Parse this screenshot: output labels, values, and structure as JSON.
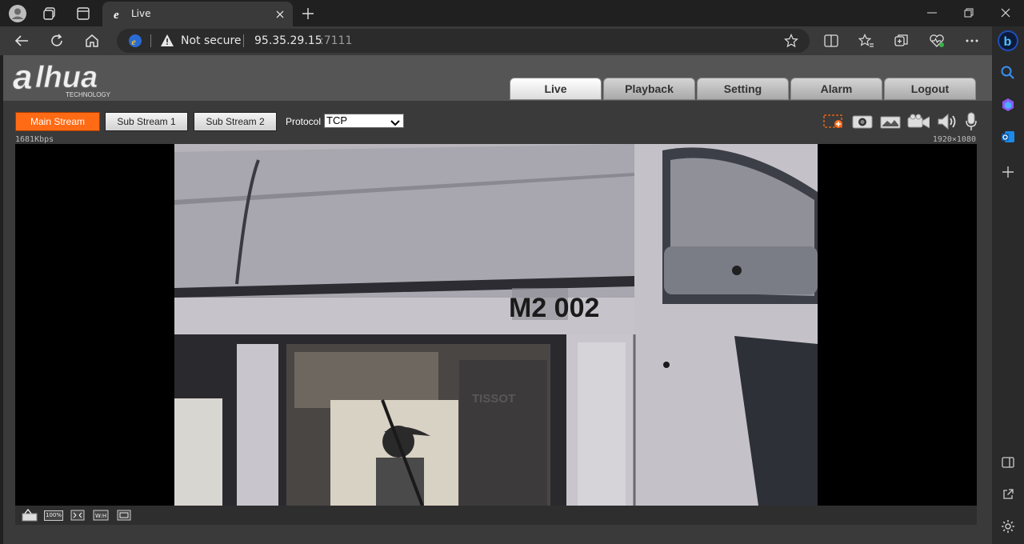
{
  "browser": {
    "tab_title": "Live",
    "url_warning": "Not secure",
    "url_host": "95.35.29.15",
    "url_port": ":7111"
  },
  "app": {
    "logo_text": "alhua",
    "logo_sub": "TECHNOLOGY",
    "menu": [
      "Live",
      "Playback",
      "Setting",
      "Alarm",
      "Logout"
    ],
    "active_menu": "Live"
  },
  "stream": {
    "main": "Main Stream",
    "sub1": "Sub Stream 1",
    "sub2": "Sub Stream 2",
    "protocol_label": "Protocol",
    "protocol_value": "TCP",
    "bitrate": "1681Kbps",
    "resolution": "1920×1080"
  },
  "toolbar_icons": [
    "zoom-region-icon",
    "snapshot-icon",
    "triple-snapshot-icon",
    "record-icon",
    "audio-icon",
    "microphone-icon"
  ],
  "video": {
    "vehicle_label": "M2 002",
    "zoom_label": "100%"
  },
  "colors": {
    "accent": "#ff6a14",
    "page_bg": "#3a3a3a"
  }
}
